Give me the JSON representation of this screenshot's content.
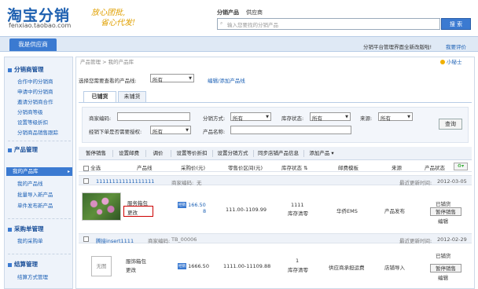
{
  "header": {
    "logo_main": "淘宝分销",
    "logo_sub": "fenxiao.taobao.com",
    "slogan_line1": "放心团批,",
    "slogan_line2": "省心代发!",
    "search_tabs": [
      "分销产品",
      "供应商"
    ],
    "search_placeholder": "输入您要找的分销产品",
    "search_button": "搜 索"
  },
  "nav": {
    "home": "我是供应商",
    "right_text": "分销平台管理界面全新改版啦!",
    "right_link": "我要评价"
  },
  "sidebar": {
    "sections": [
      {
        "title": "分销商管理",
        "items": [
          "合作中的分销商",
          "申请中的分销商",
          "邀请分销商合作",
          "分销商等级",
          "设置等级折扣",
          "分销商品销售跟踪"
        ]
      },
      {
        "title": "产品管理",
        "items": [
          "我的产品库",
          "我的产品线",
          "批量导入新产品",
          "单件发布新产品"
        ]
      },
      {
        "title": "采购单管理",
        "items": [
          "我的采购单"
        ]
      },
      {
        "title": "结算管理",
        "items": [
          "结算方式管理"
        ]
      }
    ],
    "active_item": "我的产品库"
  },
  "breadcrumb": "产品管理 > 我的产品库",
  "help_link": "小秘士",
  "product_line": {
    "label": "选择您需要查看的产品线:",
    "value": "所有",
    "edit_link": "编辑/添加产品线"
  },
  "tabs": [
    "已铺货",
    "未铺货"
  ],
  "filter": {
    "product_code_label": "商家编码:",
    "dist_method_label": "分销方式:",
    "dist_method_value": "所有",
    "stock_status_label": "库存状态:",
    "stock_status_value": "所有",
    "source_label": "来源:",
    "source_value": "所有",
    "auth_label": "经销下单是否需要授权:",
    "auth_value": "所有",
    "product_name_label": "产品名称:",
    "query_button": "查询"
  },
  "toolbar": [
    "暂停销售",
    "设置邮费",
    "调价",
    "设置等价折扣",
    "设置分销方式",
    "同步店铺产品信息",
    "添加产品 ▾"
  ],
  "table": {
    "headers": [
      "全选",
      "产品线",
      "采购价(元)",
      "零售价区间(元)",
      "库存状态",
      "邮费模板",
      "来源",
      "产品状态"
    ],
    "rows": [
      {
        "group_name": "111111111111111111",
        "group_code_label": "商家编码:",
        "group_code": "无",
        "update_label": "最近更新时间:",
        "update_date": "2012-03-05",
        "product_line": "服务箱包",
        "edit_link": "更改",
        "price_tag": "经销",
        "price": "166.50",
        "price_extra": "8",
        "retail_range": "111.00-1109.99",
        "stock": "1111",
        "stock_label": "库存清零",
        "shipping": "华侨EMS",
        "source": "产品发布",
        "status": "",
        "action_button": "暂停销售",
        "action_link": "编辑"
      },
      {
        "group_name": "腾接insert1111",
        "group_code_label": "商家编码:",
        "group_code": "TB_00006",
        "update_label": "最近更新时间:",
        "update_date": "2012-02-29",
        "image_placeholder": "无图",
        "product_line": "服饰箱包",
        "edit_link": "更改",
        "price_tag": "经销",
        "price": "1666.50",
        "retail_range": "1111.00-11109.88",
        "stock": "1",
        "stock_label": "库存清零",
        "shipping": "供应商承担运费",
        "source": "店铺导入",
        "status": "已铺货",
        "action_button": "暂停销售",
        "action_link": "编辑"
      }
    ],
    "first_row_status": "已铺货"
  },
  "colors": {
    "brand": "#1c5fb0",
    "accent": "#3b7ad1",
    "highlight_box": "#cc0000"
  }
}
